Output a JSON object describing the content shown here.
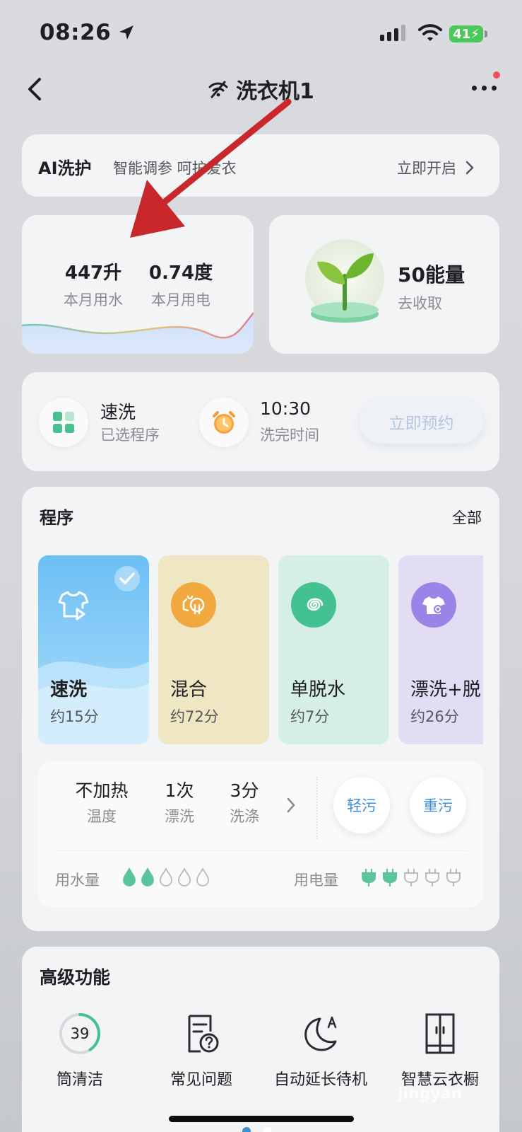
{
  "status_bar": {
    "time": "08:26",
    "battery": "41"
  },
  "nav": {
    "title": "洗衣机1"
  },
  "ai_card": {
    "title": "AI洗护",
    "description": "智能调参 呵护爱衣",
    "action": "立即开启"
  },
  "stats": {
    "water_value": "447升",
    "water_label": "本月用水",
    "power_value": "0.74度",
    "power_label": "本月用电"
  },
  "energy": {
    "value": "50能量",
    "action": "去收取"
  },
  "schedule": {
    "program_value": "速洗",
    "program_label": "已选程序",
    "time_value": "10:30",
    "time_label": "洗完时间",
    "book_button": "立即预约"
  },
  "program": {
    "title": "程序",
    "all_link": "全部",
    "tiles": [
      {
        "name": "速洗",
        "duration": "约15分",
        "selected": true,
        "icon": "shirt-play-icon",
        "color": "#63b9f4"
      },
      {
        "name": "混合",
        "duration": "约72分",
        "selected": false,
        "icon": "mixed-clothes-icon",
        "color": "#f0a83f"
      },
      {
        "name": "单脱水",
        "duration": "约7分",
        "selected": false,
        "icon": "spin-spiral-icon",
        "color": "#43c191"
      },
      {
        "name": "漂洗+脱",
        "duration": "约26分",
        "selected": false,
        "icon": "rinse-shirt-icon",
        "color": "#9b84e8"
      }
    ],
    "options": [
      {
        "value": "不加热",
        "label": "温度"
      },
      {
        "value": "1次",
        "label": "漂洗"
      },
      {
        "value": "3分",
        "label": "洗涤"
      }
    ],
    "soil_light": "轻污",
    "soil_heavy": "重污",
    "water_usage_label": "用水量",
    "water_usage_level": 2,
    "water_usage_max": 5,
    "power_usage_label": "用电量",
    "power_usage_level": 2,
    "power_usage_max": 5
  },
  "advanced": {
    "title": "高级功能",
    "items": [
      {
        "label": "筒清洁",
        "badge": "39",
        "icon": "drum-clean-ring-icon"
      },
      {
        "label": "常见问题",
        "icon": "faq-document-icon"
      },
      {
        "label": "自动延长待机",
        "icon": "moon-auto-icon"
      },
      {
        "label": "智慧云衣橱",
        "icon": "wardrobe-icon"
      }
    ]
  },
  "watermark": "jingyan",
  "colors": {
    "accent_blue": "#3f8fd6",
    "green": "#43c191",
    "arrow_red": "#c8282c"
  }
}
